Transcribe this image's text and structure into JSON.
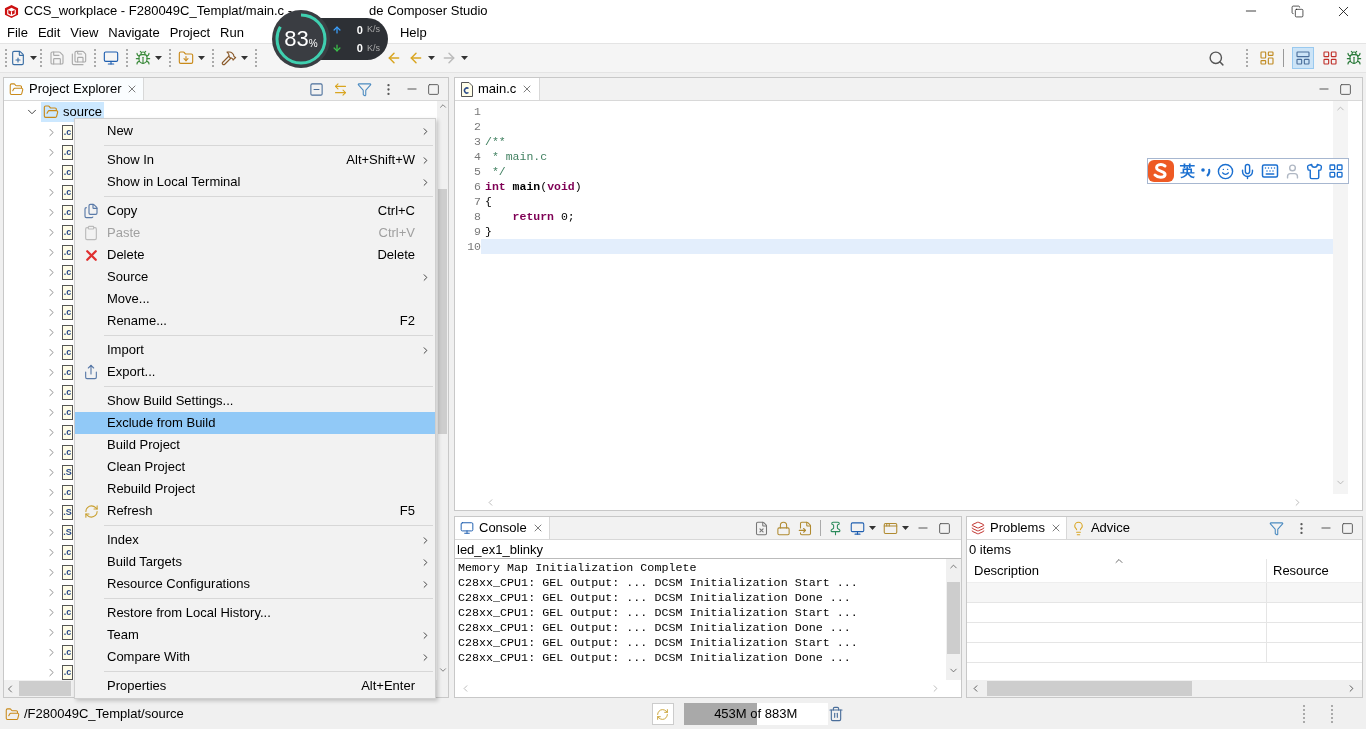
{
  "window": {
    "title_start": "CCS_workplace - F280049C_Templat/main.c -",
    "title_end": "de Composer Studio"
  },
  "menu": [
    "File",
    "Edit",
    "View",
    "Navigate",
    "Project",
    "Run",
    "Help"
  ],
  "net_widget": {
    "percent": "83",
    "unit": "%",
    "up": "0",
    "up_unit": "K/s",
    "down": "0",
    "down_unit": "K/s"
  },
  "explorer": {
    "title": "Project Explorer",
    "tree": {
      "label": "source",
      "expanded": true,
      "selected": true,
      "children": [
        {
          "badge": ".c",
          "expanded": false
        },
        {
          "badge": ".c",
          "expanded": false
        },
        {
          "badge": ".c",
          "expanded": false
        },
        {
          "badge": ".c",
          "expanded": false
        },
        {
          "badge": ".c",
          "expanded": false
        },
        {
          "badge": ".c",
          "expanded": false
        },
        {
          "badge": ".c",
          "expanded": false
        },
        {
          "badge": ".c",
          "expanded": false
        },
        {
          "badge": ".c",
          "expanded": false
        },
        {
          "badge": ".c",
          "expanded": false
        },
        {
          "badge": ".c",
          "expanded": false
        },
        {
          "badge": ".c",
          "expanded": false
        },
        {
          "badge": ".c",
          "expanded": false
        },
        {
          "badge": ".c",
          "expanded": false
        },
        {
          "badge": ".c",
          "expanded": false
        },
        {
          "badge": ".c",
          "expanded": false
        },
        {
          "badge": ".c",
          "expanded": false
        },
        {
          "badge": ".S",
          "expanded": false
        },
        {
          "badge": ".c",
          "expanded": false
        },
        {
          "badge": ".S",
          "expanded": false
        },
        {
          "badge": ".S",
          "expanded": false
        },
        {
          "badge": ".c",
          "expanded": false
        },
        {
          "badge": ".c",
          "expanded": false
        },
        {
          "badge": ".c",
          "expanded": false
        },
        {
          "badge": ".c",
          "expanded": false
        },
        {
          "badge": ".c",
          "expanded": false
        },
        {
          "badge": ".c",
          "expanded": false
        },
        {
          "badge": ".c",
          "expanded": false
        }
      ]
    }
  },
  "context_menu": {
    "groups": [
      [
        {
          "label": "New",
          "kind": "plain",
          "submenu": true,
          "disabled": false,
          "selected": false
        }
      ],
      [
        {
          "label": "Show In",
          "shortcut": "Alt+Shift+W",
          "kind": "plain",
          "submenu": true,
          "disabled": false,
          "selected": false
        },
        {
          "label": "Show in Local Terminal",
          "kind": "plain",
          "submenu": true,
          "disabled": false,
          "selected": false
        }
      ],
      [
        {
          "label": "Copy",
          "shortcut": "Ctrl+C",
          "kind": "copy",
          "submenu": false,
          "disabled": false,
          "selected": false
        },
        {
          "label": "Paste",
          "shortcut": "Ctrl+V",
          "kind": "paste",
          "submenu": false,
          "disabled": true,
          "selected": false
        },
        {
          "label": "Delete",
          "shortcut": "Delete",
          "kind": "delete",
          "submenu": false,
          "disabled": false,
          "selected": false
        },
        {
          "label": "Source",
          "kind": "plain",
          "submenu": true,
          "disabled": false,
          "selected": false
        },
        {
          "label": "Move...",
          "kind": "plain",
          "submenu": false,
          "disabled": false,
          "selected": false
        },
        {
          "label": "Rename...",
          "shortcut": "F2",
          "kind": "plain",
          "submenu": false,
          "disabled": false,
          "selected": false
        }
      ],
      [
        {
          "label": "Import",
          "kind": "plain",
          "submenu": true,
          "disabled": false,
          "selected": false
        },
        {
          "label": "Export...",
          "kind": "export",
          "submenu": false,
          "disabled": false,
          "selected": false
        }
      ],
      [
        {
          "label": "Show Build Settings...",
          "kind": "plain",
          "submenu": false,
          "disabled": false,
          "selected": false
        },
        {
          "label": "Exclude from Build",
          "kind": "plain",
          "submenu": false,
          "disabled": false,
          "selected": true
        },
        {
          "label": "Build Project",
          "kind": "plain",
          "submenu": false,
          "disabled": false,
          "selected": false
        },
        {
          "label": "Clean Project",
          "kind": "plain",
          "submenu": false,
          "disabled": false,
          "selected": false
        },
        {
          "label": "Rebuild Project",
          "kind": "plain",
          "submenu": false,
          "disabled": false,
          "selected": false
        },
        {
          "label": "Refresh",
          "shortcut": "F5",
          "kind": "refresh",
          "submenu": false,
          "disabled": false,
          "selected": false
        }
      ],
      [
        {
          "label": "Index",
          "kind": "plain",
          "submenu": true,
          "disabled": false,
          "selected": false
        },
        {
          "label": "Build Targets",
          "kind": "plain",
          "submenu": true,
          "disabled": false,
          "selected": false
        },
        {
          "label": "Resource Configurations",
          "kind": "plain",
          "submenu": true,
          "disabled": false,
          "selected": false
        }
      ],
      [
        {
          "label": "Restore from Local History...",
          "kind": "plain",
          "submenu": false,
          "disabled": false,
          "selected": false
        },
        {
          "label": "Team",
          "kind": "plain",
          "submenu": true,
          "disabled": false,
          "selected": false
        },
        {
          "label": "Compare With",
          "kind": "plain",
          "submenu": true,
          "disabled": false,
          "selected": false
        }
      ],
      [
        {
          "label": "Properties",
          "shortcut": "Alt+Enter",
          "kind": "plain",
          "submenu": false,
          "disabled": false,
          "selected": false
        }
      ]
    ]
  },
  "editor": {
    "tab": "main.c",
    "lines": [
      {
        "number": "1",
        "current": false
      },
      {
        "number": "2",
        "current": false
      },
      {
        "number": "3",
        "current": false,
        "tokens": [
          {
            "kind": "comment",
            "text": "/**"
          }
        ]
      },
      {
        "number": "4",
        "current": false,
        "tokens": [
          {
            "kind": "comment",
            "text": " * main.c"
          }
        ]
      },
      {
        "number": "5",
        "current": false,
        "tokens": [
          {
            "kind": "comment",
            "text": " */"
          }
        ]
      },
      {
        "number": "6",
        "current": false,
        "tokens": [
          {
            "kind": "keyword",
            "text": "int"
          },
          {
            "kind": "bold",
            "text": " main"
          },
          {
            "kind": "plain",
            "text": "("
          },
          {
            "kind": "keyword",
            "text": "void"
          },
          {
            "kind": "plain",
            "text": ")"
          }
        ]
      },
      {
        "number": "7",
        "current": false,
        "tokens": [
          {
            "kind": "plain",
            "text": "{"
          }
        ]
      },
      {
        "number": "8",
        "current": false,
        "tokens": [
          {
            "kind": "keyword",
            "text": "    return"
          },
          {
            "kind": "plain",
            "text": " 0;"
          }
        ]
      },
      {
        "number": "9",
        "current": false,
        "tokens": [
          {
            "kind": "plain",
            "text": "}"
          }
        ]
      },
      {
        "number": "10",
        "current": true
      }
    ]
  },
  "ime_bar": {
    "label": "英"
  },
  "console": {
    "title": "Console",
    "name": "led_ex1_blinky",
    "lines": [
      "Memory Map Initialization Complete",
      "C28xx_CPU1: GEL Output: ... DCSM Initialization Start ...",
      "C28xx_CPU1: GEL Output: ... DCSM Initialization Done ...",
      "C28xx_CPU1: GEL Output: ... DCSM Initialization Start ...",
      "C28xx_CPU1: GEL Output: ... DCSM Initialization Done ...",
      "C28xx_CPU1: GEL Output: ... DCSM Initialization Start ...",
      "C28xx_CPU1: GEL Output: ... DCSM Initialization Done ..."
    ]
  },
  "problems": {
    "tabs": [
      {
        "label": "Problems",
        "selected": true
      },
      {
        "label": "Advice",
        "selected": false
      }
    ],
    "summary": "0 items",
    "columns": [
      "Description",
      "Resource"
    ]
  },
  "status_bar": {
    "path": "/F280049C_Templat/source",
    "heap": {
      "text": "453M of 883M",
      "level": 0.51
    }
  }
}
